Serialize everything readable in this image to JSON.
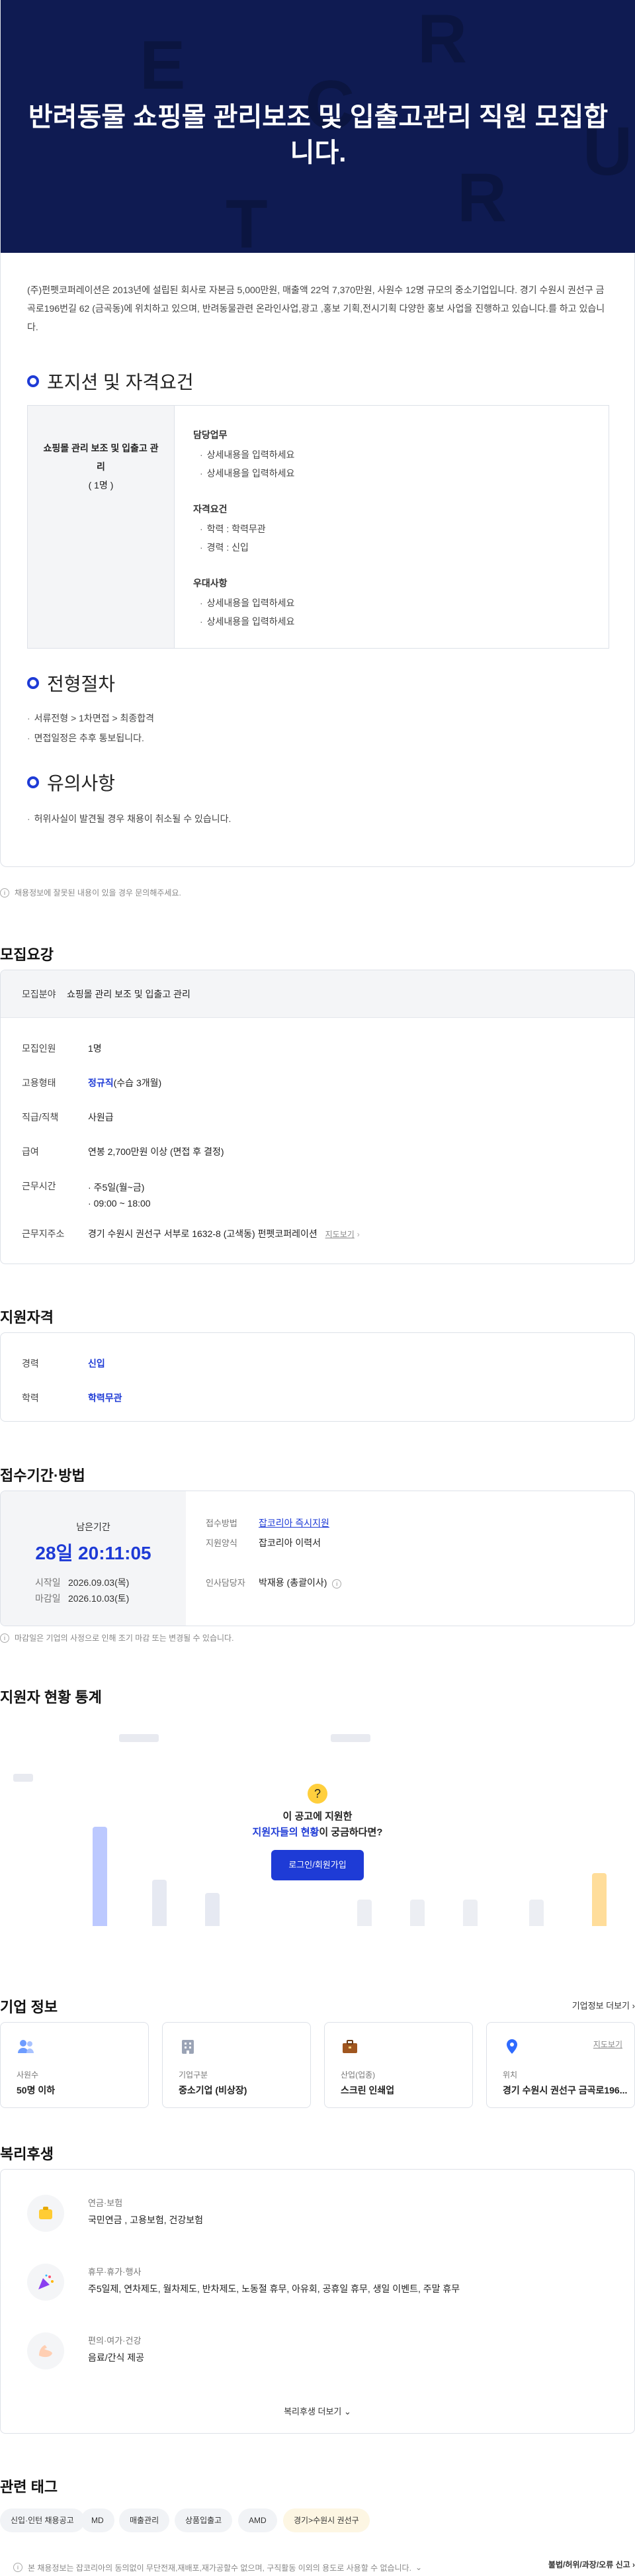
{
  "hero": {
    "title": "반려동물 쇼핑몰 관리보조 및 입출고관리 직원 모집합니다.",
    "letters": [
      "E",
      "R",
      "C",
      "U",
      "T",
      "R"
    ]
  },
  "intro": "(주)펀펫코퍼레이션은 2013년에 설립된 회사로 자본금 5,000만원, 매출액 22억 7,370만원, 사원수 12명 규모의 중소기업입니다. 경기 수원시 권선구 금곡로196번길 62 (금곡동)에 위치하고 있으며, 반려동물관련 온라인사업,광고 ,홍보 기획,전시기획 다양한 홍보 사업을 진행하고 있습니다.를 하고 있습니다.",
  "sections": {
    "position": "포지션 및 자격요건",
    "process": "전형절차",
    "caution": "유의사항"
  },
  "position": {
    "name": "쇼핑몰 관리 보조 및 입출고 관리",
    "count": "( 1명 )",
    "duties_title": "담당업무",
    "duties": [
      "상세내용을 입력하세요",
      "상세내용을 입력하세요"
    ],
    "req_title": "자격요건",
    "reqs": [
      "학력 : 학력무관",
      "경력 : 신입"
    ],
    "pref_title": "우대사항",
    "prefs": [
      "상세내용을 입력하세요",
      "상세내용을 입력하세요"
    ]
  },
  "process": [
    "서류전형 > 1차면접 > 최종합격",
    "면접일정은 추후 통보됩니다."
  ],
  "caution": [
    "허위사실이 발견될 경우 채용이 취소될 수 있습니다."
  ],
  "notice_text": "채용정보에 잘못된 내용이 있을 경우 문의해주세요.",
  "summary": {
    "title": "모집요강",
    "field_label": "모집분야",
    "field_value": "쇼핑몰 관리 보조 및 입출고 관리",
    "headcount_label": "모집인원",
    "headcount_value": "1명",
    "type_label": "고용형태",
    "type_value": "정규직",
    "type_note": "(수습 3개월)",
    "rank_label": "직급/직책",
    "rank_value": "사원급",
    "salary_label": "급여",
    "salary_value": "연봉 2,700만원 이상 (면접 후 결정)",
    "hours_label": "근무시간",
    "hours_days": "주5일(월~금)",
    "hours_time": "09:00 ~ 18:00",
    "address_label": "근무지주소",
    "address_value": "경기 수원시 권선구 서부로 1632-8 (고색동) 펀펫코퍼레이션",
    "map_link": "지도보기"
  },
  "qualification": {
    "title": "지원자격",
    "exp_label": "경력",
    "exp_value": "신입",
    "edu_label": "학력",
    "edu_value": "학력무관"
  },
  "apply": {
    "title": "접수기간·방법",
    "remain_label": "남은기간",
    "remain_value": "28일 20:11:05",
    "start_label": "시작일",
    "start_value": "2026.09.03(목)",
    "end_label": "마감일",
    "end_value": "2026.10.03(토)",
    "method_label": "접수방법",
    "method_value": "잡코리아 즉시지원",
    "form_label": "지원양식",
    "form_value": "잡코리아 이력서",
    "hr_label": "인사담당자",
    "hr_value": "박재용 (총괄이사)",
    "notice": "마감일은 기업의 사정으로 인해 조기 마감 또는 변경될 수 있습니다."
  },
  "stats": {
    "title": "지원자 현황 통계",
    "question_1": "이 공고에 지원한",
    "question_2_blue": "지원자들의 현황",
    "question_2_rest": "이 궁금하다면?",
    "button": "로그인/회원가입"
  },
  "company": {
    "title": "기업 정보",
    "more": "기업정보 더보기",
    "cards": [
      {
        "label": "사원수",
        "value": "50명 이하",
        "icon": "people-icon"
      },
      {
        "label": "기업구분",
        "value": "중소기업 (비상장)",
        "icon": "building-icon"
      },
      {
        "label": "산업(업종)",
        "value": "스크린 인쇄업",
        "icon": "briefcase-icon"
      },
      {
        "label": "위치",
        "value": "경기 수원시 권선구 금곡로196...",
        "icon": "location-pin-icon",
        "link": "지도보기"
      }
    ]
  },
  "welfare": {
    "title": "복리후생",
    "groups": [
      {
        "category": "연금·보험",
        "items": "국민연금 , 고용보험, 건강보험",
        "icon": "piggy-bank-icon"
      },
      {
        "category": "휴무·휴가·행사",
        "items": "주5일제, 연차제도, 월차제도, 반차제도, 노동절 휴무, 아유회, 공휴일 휴무, 생일 이벤트, 주말 휴무",
        "icon": "party-popper-icon"
      },
      {
        "category": "편의·여가·건강",
        "items": "음료/간식 제공",
        "icon": "muscle-icon"
      }
    ],
    "more": "복리후생 더보기"
  },
  "tags": {
    "title": "관련 태그",
    "items": [
      "신입·인턴 채용공고",
      "MD",
      "매출관리",
      "상품입출고",
      "AMD",
      "경기>수원시 권선구"
    ]
  },
  "footer": {
    "note": "본 채용정보는 잡코리아의 동의없이 무단전재,재배포,재가공할수 없으며, 구직활동 이외의 용도로 사용할 수 없습니다.",
    "report": "불법/허위/과장/오류 신고"
  },
  "colors": {
    "accent": "#1e3bd6",
    "hero_bg": "#0f1b52"
  }
}
